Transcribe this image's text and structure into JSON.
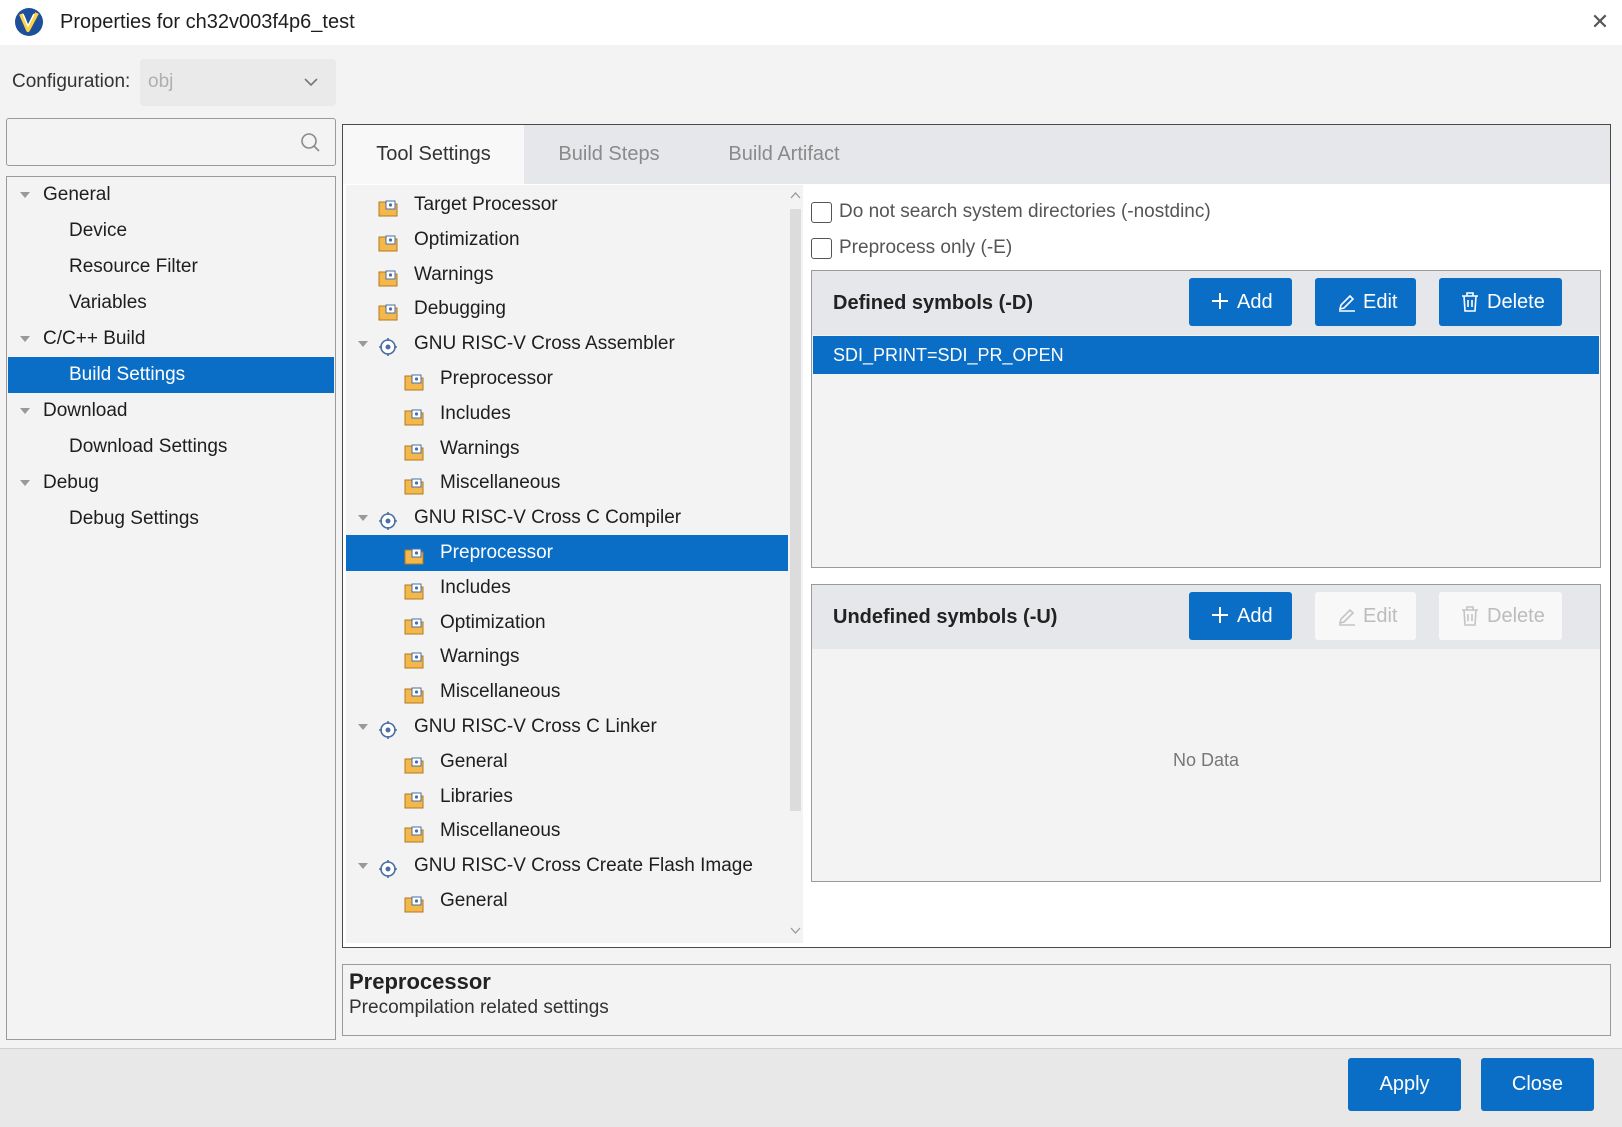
{
  "window": {
    "title": "Properties for ch32v003f4p6_test"
  },
  "config": {
    "label": "Configuration:",
    "value": "obj"
  },
  "left_tree": {
    "search_placeholder": "",
    "items": [
      {
        "label": "General"
      },
      {
        "label": "Device"
      },
      {
        "label": "Resource Filter"
      },
      {
        "label": "Variables"
      },
      {
        "label": "C/C++ Build"
      },
      {
        "label": "Build Settings"
      },
      {
        "label": "Download"
      },
      {
        "label": "Download Settings"
      },
      {
        "label": "Debug"
      },
      {
        "label": "Debug Settings"
      }
    ]
  },
  "tabs": [
    {
      "label": "Tool Settings"
    },
    {
      "label": "Build Steps"
    },
    {
      "label": "Build Artifact"
    }
  ],
  "tool_tree": [
    {
      "label": "Target Processor"
    },
    {
      "label": "Optimization"
    },
    {
      "label": "Warnings"
    },
    {
      "label": "Debugging"
    },
    {
      "label": "GNU RISC-V Cross Assembler"
    },
    {
      "label": "Preprocessor"
    },
    {
      "label": "Includes"
    },
    {
      "label": "Warnings"
    },
    {
      "label": "Miscellaneous"
    },
    {
      "label": "GNU RISC-V Cross C Compiler"
    },
    {
      "label": "Preprocessor"
    },
    {
      "label": "Includes"
    },
    {
      "label": "Optimization"
    },
    {
      "label": "Warnings"
    },
    {
      "label": "Miscellaneous"
    },
    {
      "label": "GNU RISC-V Cross C Linker"
    },
    {
      "label": "General"
    },
    {
      "label": "Libraries"
    },
    {
      "label": "Miscellaneous"
    },
    {
      "label": "GNU RISC-V Cross Create Flash Image"
    },
    {
      "label": "General"
    }
  ],
  "options": {
    "nostdinc": {
      "label": "Do not search system directories (-nostdinc)",
      "checked": false
    },
    "preprocess_only": {
      "label": "Preprocess only (-E)",
      "checked": false
    }
  },
  "defined": {
    "title": "Defined symbols (-D)",
    "add": "Add",
    "edit": "Edit",
    "delete": "Delete",
    "rows": [
      "SDI_PRINT=SDI_PR_OPEN"
    ]
  },
  "undefined": {
    "title": "Undefined symbols (-U)",
    "add": "Add",
    "edit": "Edit",
    "delete": "Delete",
    "empty": "No Data"
  },
  "description": {
    "title": "Preprocessor",
    "text": "Precompilation related settings"
  },
  "footer": {
    "apply": "Apply",
    "close": "Close"
  },
  "colors": {
    "accent": "#0a6ec7",
    "panel": "#f3f3f3",
    "tab_bg": "#e5e7ea"
  }
}
